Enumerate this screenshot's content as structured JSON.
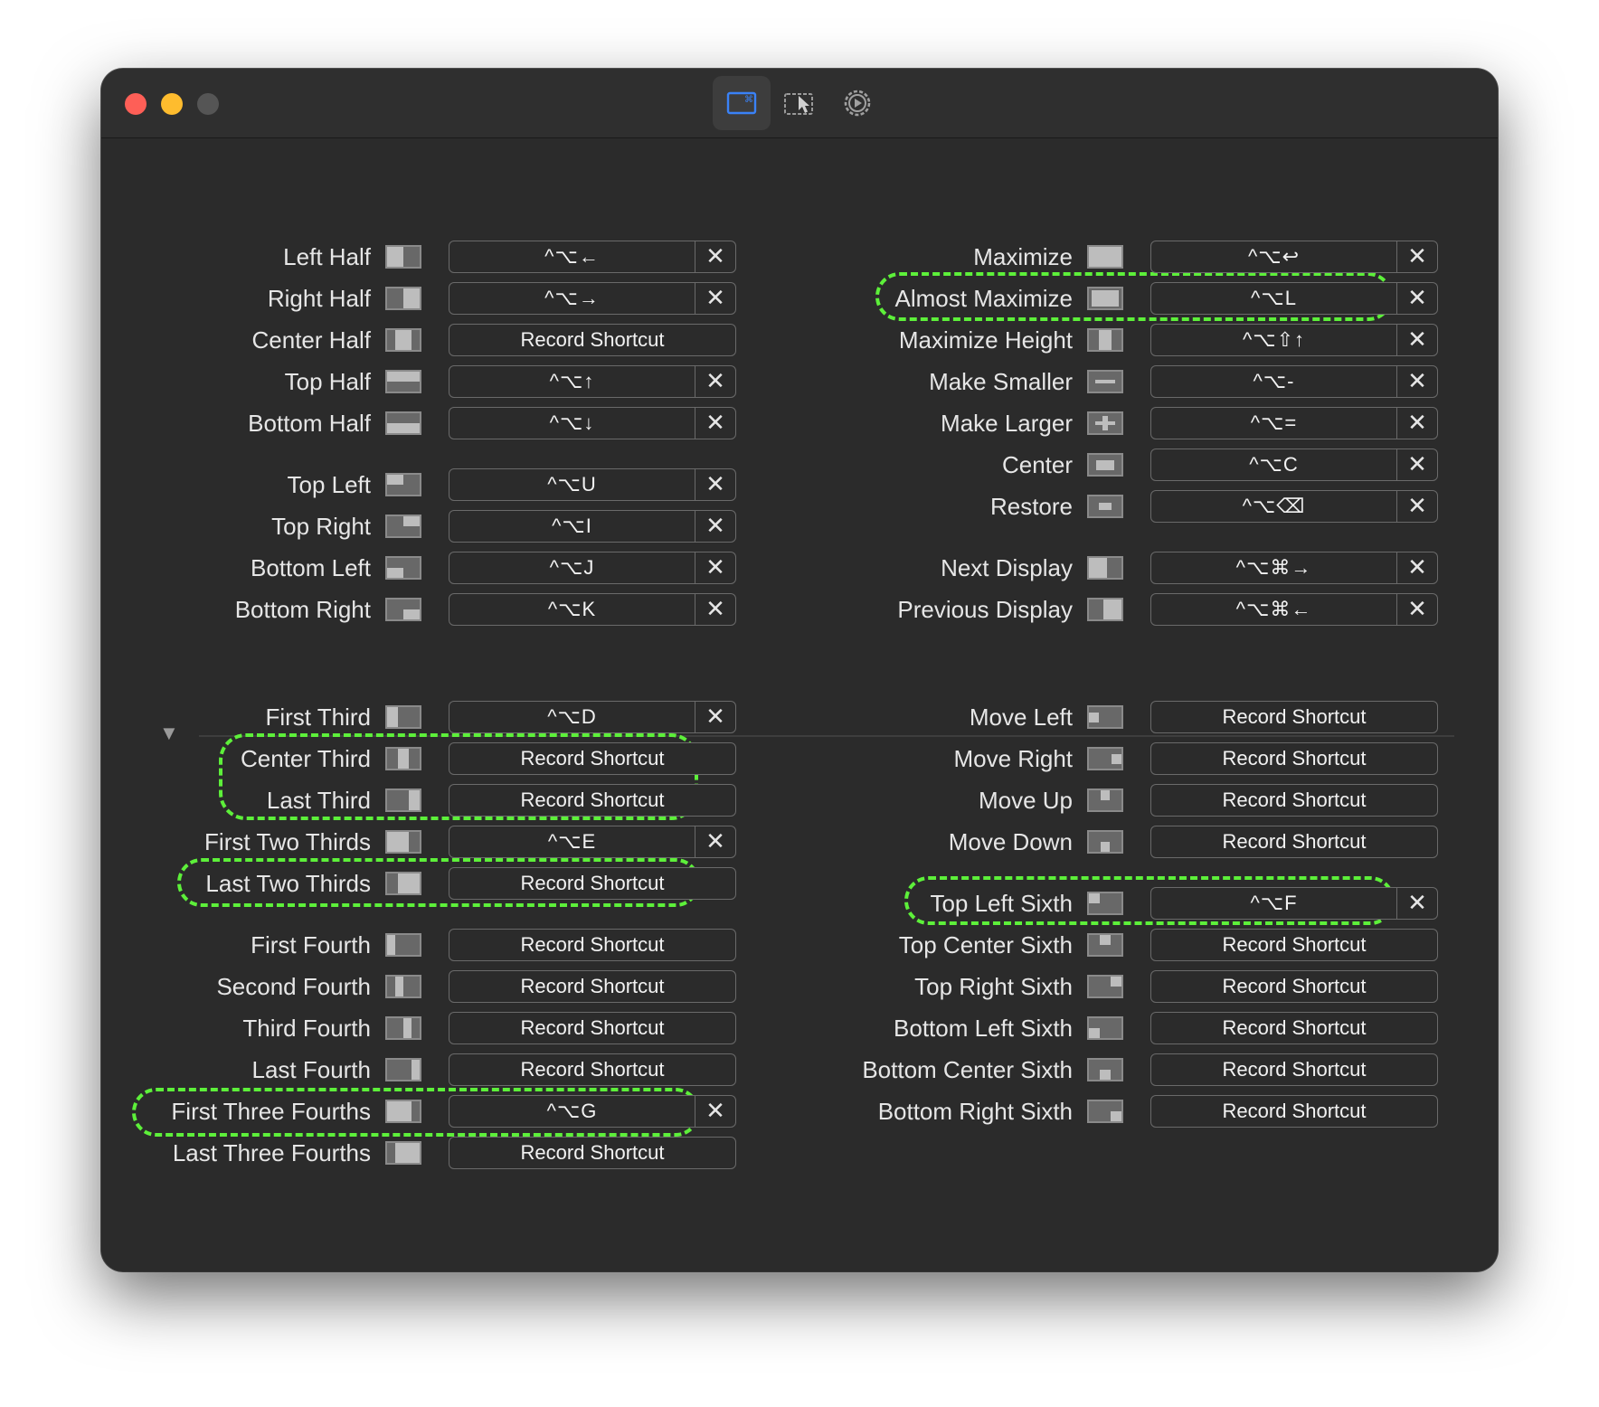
{
  "toolbar": {
    "tabs": [
      {
        "icon": "shortcuts-icon",
        "active": true
      },
      {
        "icon": "snap-areas-icon",
        "active": false
      },
      {
        "icon": "settings-gear-icon",
        "active": false
      }
    ]
  },
  "colors": {
    "accent": "#3a82f7",
    "highlight": "#5df03a",
    "background": "#2b2b2b"
  },
  "left_column": [
    {
      "label": "Left Half",
      "shortcut": "^⌥←",
      "icon": "left-half-icon"
    },
    {
      "label": "Right Half",
      "shortcut": "^⌥→",
      "icon": "right-half-icon"
    },
    {
      "label": "Center Half",
      "shortcut": "",
      "icon": "center-half-icon"
    },
    {
      "label": "Top Half",
      "shortcut": "^⌥↑",
      "icon": "top-half-icon"
    },
    {
      "label": "Bottom Half",
      "shortcut": "^⌥↓",
      "icon": "bottom-half-icon"
    },
    {
      "label": "Top Left",
      "shortcut": "^⌥U",
      "icon": "top-left-icon"
    },
    {
      "label": "Top Right",
      "shortcut": "^⌥I",
      "icon": "top-right-icon"
    },
    {
      "label": "Bottom Left",
      "shortcut": "^⌥J",
      "icon": "bottom-left-icon"
    },
    {
      "label": "Bottom Right",
      "shortcut": "^⌥K",
      "icon": "bottom-right-icon"
    }
  ],
  "right_column": [
    {
      "label": "Maximize",
      "shortcut": "^⌥↩",
      "icon": "maximize-icon"
    },
    {
      "label": "Almost Maximize",
      "shortcut": "^⌥L",
      "icon": "almost-maximize-icon"
    },
    {
      "label": "Maximize Height",
      "shortcut": "^⌥⇧↑",
      "icon": "maximize-height-icon"
    },
    {
      "label": "Make Smaller",
      "shortcut": "^⌥-",
      "icon": "make-smaller-icon"
    },
    {
      "label": "Make Larger",
      "shortcut": "^⌥=",
      "icon": "make-larger-icon"
    },
    {
      "label": "Center",
      "shortcut": "^⌥C",
      "icon": "center-icon"
    },
    {
      "label": "Restore",
      "shortcut": "^⌥⌫",
      "icon": "restore-icon"
    },
    {
      "label": "Next Display",
      "shortcut": "^⌥⌘→",
      "icon": "next-display-icon"
    },
    {
      "label": "Previous Display",
      "shortcut": "^⌥⌘←",
      "icon": "previous-display-icon"
    }
  ],
  "left_column_more": [
    {
      "label": "First Third",
      "shortcut": "^⌥D",
      "icon": "first-third-icon"
    },
    {
      "label": "Center Third",
      "shortcut": "",
      "icon": "center-third-icon"
    },
    {
      "label": "Last Third",
      "shortcut": "",
      "icon": "last-third-icon"
    },
    {
      "label": "First Two Thirds",
      "shortcut": "^⌥E",
      "icon": "first-two-thirds-icon"
    },
    {
      "label": "Last Two Thirds",
      "shortcut": "",
      "icon": "last-two-thirds-icon"
    },
    {
      "label": "First Fourth",
      "shortcut": "",
      "icon": "first-fourth-icon"
    },
    {
      "label": "Second Fourth",
      "shortcut": "",
      "icon": "second-fourth-icon"
    },
    {
      "label": "Third Fourth",
      "shortcut": "",
      "icon": "third-fourth-icon"
    },
    {
      "label": "Last Fourth",
      "shortcut": "",
      "icon": "last-fourth-icon"
    },
    {
      "label": "First Three Fourths",
      "shortcut": "^⌥G",
      "icon": "first-three-fourths-icon"
    },
    {
      "label": "Last Three Fourths",
      "shortcut": "",
      "icon": "last-three-fourths-icon"
    }
  ],
  "right_column_more": [
    {
      "label": "Move Left",
      "shortcut": "",
      "icon": "move-left-icon"
    },
    {
      "label": "Move Right",
      "shortcut": "",
      "icon": "move-right-icon"
    },
    {
      "label": "Move Up",
      "shortcut": "",
      "icon": "move-up-icon"
    },
    {
      "label": "Move Down",
      "shortcut": "",
      "icon": "move-down-icon"
    },
    {
      "label": "Top Left Sixth",
      "shortcut": "^⌥F",
      "icon": "top-left-sixth-icon"
    },
    {
      "label": "Top Center Sixth",
      "shortcut": "",
      "icon": "top-center-sixth-icon"
    },
    {
      "label": "Top Right Sixth",
      "shortcut": "",
      "icon": "top-right-sixth-icon"
    },
    {
      "label": "Bottom Left Sixth",
      "shortcut": "",
      "icon": "bottom-left-sixth-icon"
    },
    {
      "label": "Bottom Center Sixth",
      "shortcut": "",
      "icon": "bottom-center-sixth-icon"
    },
    {
      "label": "Bottom Right Sixth",
      "shortcut": "",
      "icon": "bottom-right-sixth-icon"
    }
  ],
  "record_label": "Record Shortcut",
  "clear_glyph": "✕",
  "disclosure_glyph": "▼"
}
